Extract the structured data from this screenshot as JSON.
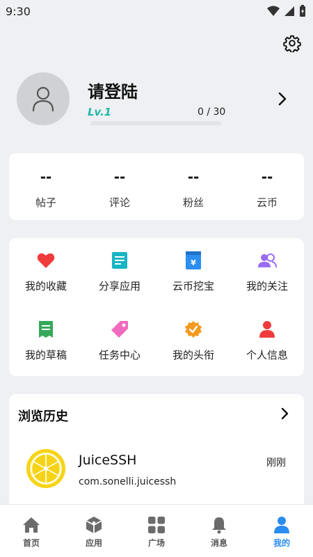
{
  "status_bar": {
    "time": "9:30"
  },
  "profile": {
    "username": "请登陆",
    "level": "Lv.1",
    "exp_text": "0 / 30",
    "exp_progress": 0
  },
  "stats": [
    {
      "value": "--",
      "label": "帖子"
    },
    {
      "value": "--",
      "label": "评论"
    },
    {
      "value": "--",
      "label": "粉丝"
    },
    {
      "value": "--",
      "label": "云币"
    }
  ],
  "menu": [
    {
      "label": "我的收藏",
      "icon": "heart-icon",
      "color": "#ef3b3b"
    },
    {
      "label": "分享应用",
      "icon": "document-icon",
      "color": "#16b5c4"
    },
    {
      "label": "云币挖宝",
      "icon": "yen-card-icon",
      "color": "#2b8ef0"
    },
    {
      "label": "我的关注",
      "icon": "people-icon",
      "color": "#9b6cf2"
    },
    {
      "label": "我的草稿",
      "icon": "draft-icon",
      "color": "#35a85a"
    },
    {
      "label": "任务中心",
      "icon": "tag-icon",
      "color": "#f06ac0"
    },
    {
      "label": "我的头衔",
      "icon": "badge-icon",
      "color": "#f39a1e"
    },
    {
      "label": "个人信息",
      "icon": "person-icon",
      "color": "#ef3b3b"
    }
  ],
  "history": {
    "title": "浏览历史",
    "items": [
      {
        "name": "JuiceSSH",
        "package": "com.sonelli.juicessh",
        "time": "刚刚",
        "icon": "lemon-icon"
      }
    ]
  },
  "nav": {
    "items": [
      {
        "label": "首页",
        "icon": "home-icon"
      },
      {
        "label": "应用",
        "icon": "cube-icon"
      },
      {
        "label": "广场",
        "icon": "grid-icon"
      },
      {
        "label": "消息",
        "icon": "bell-icon"
      },
      {
        "label": "我的",
        "icon": "user-icon"
      }
    ],
    "active_index": 4,
    "active_color": "#2a8cf0",
    "inactive_color": "#6b6b6b"
  }
}
